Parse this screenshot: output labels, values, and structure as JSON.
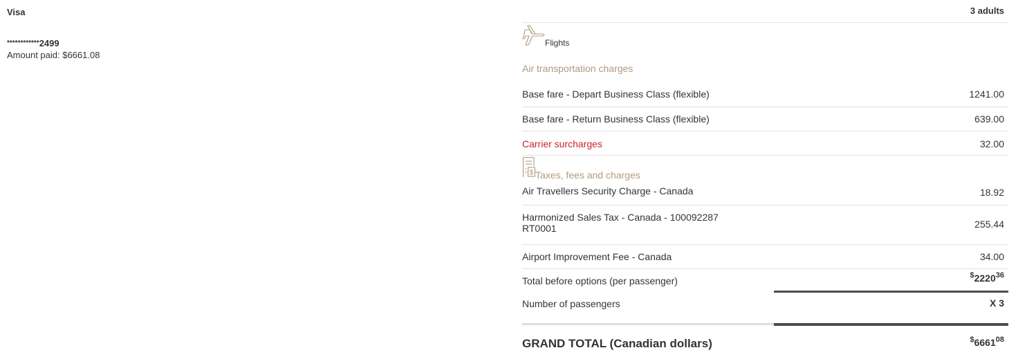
{
  "payment": {
    "card_type": "Visa",
    "card_mask": "************",
    "card_last4": "2499",
    "amount_paid": "Amount paid: $6661.08"
  },
  "summary": {
    "passengers_label": "3 adults",
    "flights_label": "Flights",
    "air_section_title": "Air transportation charges",
    "air_rows": [
      {
        "label": "Base fare - Depart Business Class (flexible)",
        "value": "1241.00"
      },
      {
        "label": "Base fare - Return Business Class (flexible)",
        "value": "639.00"
      },
      {
        "label": "Carrier surcharges",
        "value": "32.00"
      }
    ],
    "tax_section_title": "Taxes, fees and charges",
    "tax_rows": [
      {
        "label": "Air Travellers Security Charge - Canada",
        "value": "18.92"
      },
      {
        "label": "Harmonized Sales Tax - Canada - 100092287",
        "label_line2": "RT0001",
        "value": "255.44"
      },
      {
        "label": "Airport Improvement Fee - Canada",
        "value": "34.00"
      }
    ],
    "total_before": {
      "label": "Total before options (per passenger)",
      "currency": "$",
      "whole": "2220",
      "cents": "36"
    },
    "num_passengers": {
      "label": "Number of passengers",
      "value": "X 3"
    },
    "grand_total": {
      "label": "GRAND TOTAL (Canadian dollars)",
      "currency": "$",
      "whole": "6661",
      "cents": "08"
    }
  },
  "colors": {
    "accent_tan": "#b09a80",
    "alert_red": "#d0202e",
    "dark_bar": "#4a4c51"
  },
  "icons": {
    "flights": "airplane-icon",
    "taxes": "receipt-icon"
  }
}
